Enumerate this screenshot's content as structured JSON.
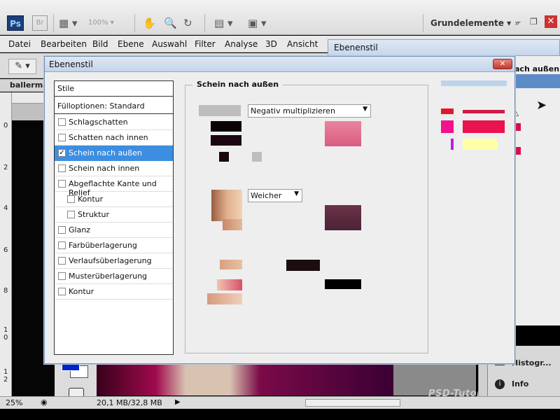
{
  "app": {
    "logo": "Ps",
    "bridge": "Br",
    "zoom": "100%",
    "workspace": "Grundelemente",
    "minimize": "–",
    "restore": "❐",
    "close": "✕"
  },
  "menu": [
    "Datei",
    "Bearbeiten",
    "Bild",
    "Ebene",
    "Auswahl",
    "Filter",
    "Analyse",
    "3D",
    "Ansicht"
  ],
  "document": {
    "tab": "ballermar",
    "ruler_ticks": [
      "0",
      "2",
      "4",
      "6",
      "8",
      "1\n0",
      "1\n2"
    ],
    "zoom_pct": "25%",
    "doc_size": "20,1 MB/32,8 MB",
    "watermark": "PSD-Tutorials.de"
  },
  "background_panel": {
    "title": "Ebenenstil",
    "right_label": "ach außen"
  },
  "right_panels": {
    "histogram": "Histogr...",
    "info": "Info"
  },
  "dialog": {
    "title": "Ebenenstil",
    "close": "✕",
    "styles_header": "Stile",
    "fill_options": "Fülloptionen: Standard",
    "items": [
      {
        "label": "Schlagschatten",
        "checked": false,
        "indent": false,
        "active": false
      },
      {
        "label": "Schatten nach innen",
        "checked": false,
        "indent": false,
        "active": false
      },
      {
        "label": "Schein nach außen",
        "checked": true,
        "indent": false,
        "active": true
      },
      {
        "label": "Schein nach innen",
        "checked": false,
        "indent": false,
        "active": false
      },
      {
        "label": "Abgeflachte Kante und Relief",
        "checked": false,
        "indent": false,
        "active": false
      },
      {
        "label": "Kontur",
        "checked": false,
        "indent": true,
        "active": false
      },
      {
        "label": "Struktur",
        "checked": false,
        "indent": true,
        "active": false
      },
      {
        "label": "Glanz",
        "checked": false,
        "indent": false,
        "active": false
      },
      {
        "label": "Farbüberlagerung",
        "checked": false,
        "indent": false,
        "active": false
      },
      {
        "label": "Verlaufsüberlagerung",
        "checked": false,
        "indent": false,
        "active": false
      },
      {
        "label": "Musterüberlagerung",
        "checked": false,
        "indent": false,
        "active": false
      },
      {
        "label": "Kontur",
        "checked": false,
        "indent": false,
        "active": false
      }
    ],
    "section_title": "Schein nach außen",
    "blend_mode": "Negativ multiplizieren",
    "technique": "Weicher"
  },
  "colors": {
    "accent_blue": "#3d8ee0",
    "glow_pink": "#e8134f",
    "glow_magenta": "#f2128c",
    "glow_yellow": "#ffffa8"
  }
}
